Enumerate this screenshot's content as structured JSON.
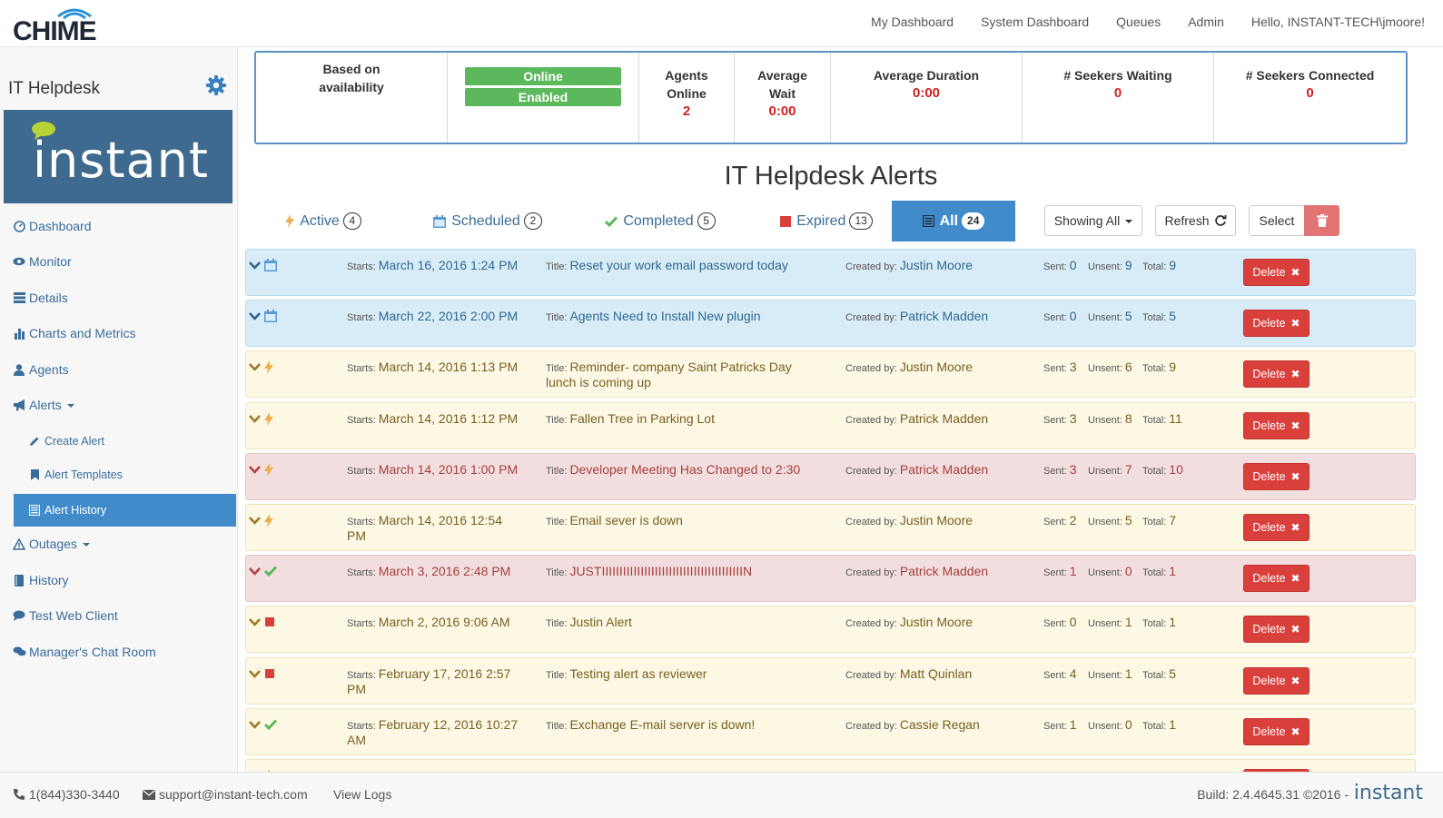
{
  "app": {
    "logo_text": "CHIME"
  },
  "topnav": {
    "items": [
      "My Dashboard",
      "System Dashboard",
      "Queues",
      "Admin",
      "Hello, INSTANT-TECH\\jmoore!"
    ]
  },
  "sidebar": {
    "queue_title": "IT Helpdesk",
    "logo_text": "instant",
    "items": [
      {
        "label": "Dashboard",
        "icon": "dashboard-icon"
      },
      {
        "label": "Monitor",
        "icon": "eye-icon"
      },
      {
        "label": "Details",
        "icon": "list-icon"
      },
      {
        "label": "Charts and Metrics",
        "icon": "bar-chart-icon"
      },
      {
        "label": "Agents",
        "icon": "user-icon"
      },
      {
        "label": "Alerts",
        "icon": "bullhorn-icon"
      },
      {
        "label": "Create Alert",
        "icon": "pencil-icon"
      },
      {
        "label": "Alert Templates",
        "icon": "bookmark-icon"
      },
      {
        "label": "Alert History",
        "icon": "list-alt-icon"
      },
      {
        "label": "Outages",
        "icon": "warning-icon"
      },
      {
        "label": "History",
        "icon": "book-icon"
      },
      {
        "label": "Test Web Client",
        "icon": "comment-icon"
      },
      {
        "label": "Manager's Chat Room",
        "icon": "comments-icon"
      }
    ]
  },
  "stats": {
    "routing": "Based on availability",
    "status_online": "Online",
    "status_enabled": "Enabled",
    "agents_online_label": "Agents Online",
    "agents_online_value": "2",
    "average_wait_label": "Average Wait",
    "average_wait_value": "0:00",
    "average_duration_label": "Average Duration",
    "average_duration_value": "0:00",
    "seekers_waiting_label": "# Seekers Waiting",
    "seekers_waiting_value": "0",
    "seekers_connected_label": "# Seekers Connected",
    "seekers_connected_value": "0"
  },
  "main": {
    "title": "IT Helpdesk Alerts",
    "tabs": [
      {
        "label": "Active",
        "count": "4"
      },
      {
        "label": "Scheduled",
        "count": "2"
      },
      {
        "label": "Completed",
        "count": "5"
      },
      {
        "label": "Expired",
        "count": "13"
      },
      {
        "label": "All",
        "count": "24"
      }
    ],
    "showing_label": "Showing All",
    "refresh_label": "Refresh",
    "select_label": "Select"
  },
  "alerts": {
    "starts_key": "Starts:",
    "title_key": "Title:",
    "created_key": "Created by:",
    "sent_key": "Sent:",
    "unsent_key": "Unsent:",
    "total_key": "Total:",
    "delete_label": "Delete",
    "colors": {
      "blue": "#d8ecf7",
      "yellow": "#fcf8e3",
      "red": "#f2dede",
      "delete": "#d9403c"
    },
    "rows": [
      {
        "status": "scheduled",
        "tone": "blue",
        "starts": "March 16, 2016 1:24 PM",
        "title": "Reset your work email password today",
        "created_by": "Justin Moore",
        "sent": "0",
        "unsent": "9",
        "total": "9"
      },
      {
        "status": "scheduled",
        "tone": "blue",
        "starts": "March 22, 2016 2:00 PM",
        "title": "Agents Need to Install New plugin",
        "created_by": "Patrick Madden",
        "sent": "0",
        "unsent": "5",
        "total": "5"
      },
      {
        "status": "active",
        "tone": "yellow",
        "starts": "March 14, 2016 1:13 PM",
        "title": "Reminder- company Saint Patricks Day lunch is coming up",
        "created_by": "Justin Moore",
        "sent": "3",
        "unsent": "6",
        "total": "9"
      },
      {
        "status": "active",
        "tone": "yellow",
        "starts": "March 14, 2016 1:12 PM",
        "title": "Fallen Tree in Parking Lot",
        "created_by": "Patrick Madden",
        "sent": "3",
        "unsent": "8",
        "total": "11"
      },
      {
        "status": "active",
        "tone": "red",
        "starts": "March 14, 2016 1:00 PM",
        "title": "Developer Meeting Has Changed to 2:30",
        "created_by": "Patrick Madden",
        "sent": "3",
        "unsent": "7",
        "total": "10"
      },
      {
        "status": "active",
        "tone": "yellow",
        "starts": "March 14, 2016 12:54 PM",
        "title": "Email sever is down",
        "created_by": "Justin Moore",
        "sent": "2",
        "unsent": "5",
        "total": "7"
      },
      {
        "status": "completed",
        "tone": "red",
        "starts": "March 3, 2016 2:48 PM",
        "title": "JUSTIIIIIIIIIIIIIIIIIIIIIIIIIIIIIIIIIIIIIIIIN",
        "created_by": "Patrick Madden",
        "sent": "1",
        "unsent": "0",
        "total": "1"
      },
      {
        "status": "expired",
        "tone": "yellow",
        "starts": "March 2, 2016 9:06 AM",
        "title": "Justin Alert",
        "created_by": "Justin Moore",
        "sent": "0",
        "unsent": "1",
        "total": "1"
      },
      {
        "status": "expired",
        "tone": "yellow",
        "starts": "February 17, 2016 2:57 PM",
        "title": "Testing alert as reviewer",
        "created_by": "Matt Quinlan",
        "sent": "4",
        "unsent": "1",
        "total": "5"
      },
      {
        "status": "completed",
        "tone": "yellow",
        "starts": "February 12, 2016 10:27 AM",
        "title": "Exchange E-mail server is down!",
        "created_by": "Cassie Regan",
        "sent": "1",
        "unsent": "0",
        "total": "1"
      },
      {
        "status": "active",
        "tone": "yellow",
        "starts": "",
        "title": "",
        "created_by": "",
        "sent": "",
        "unsent": "",
        "total": ""
      }
    ]
  },
  "footer": {
    "phone": "1(844)330-3440",
    "email": "support@instant-tech.com",
    "view_logs": "View Logs",
    "build": "Build: 2.4.4645.31 ©2016 -",
    "logo_text": "instant"
  }
}
